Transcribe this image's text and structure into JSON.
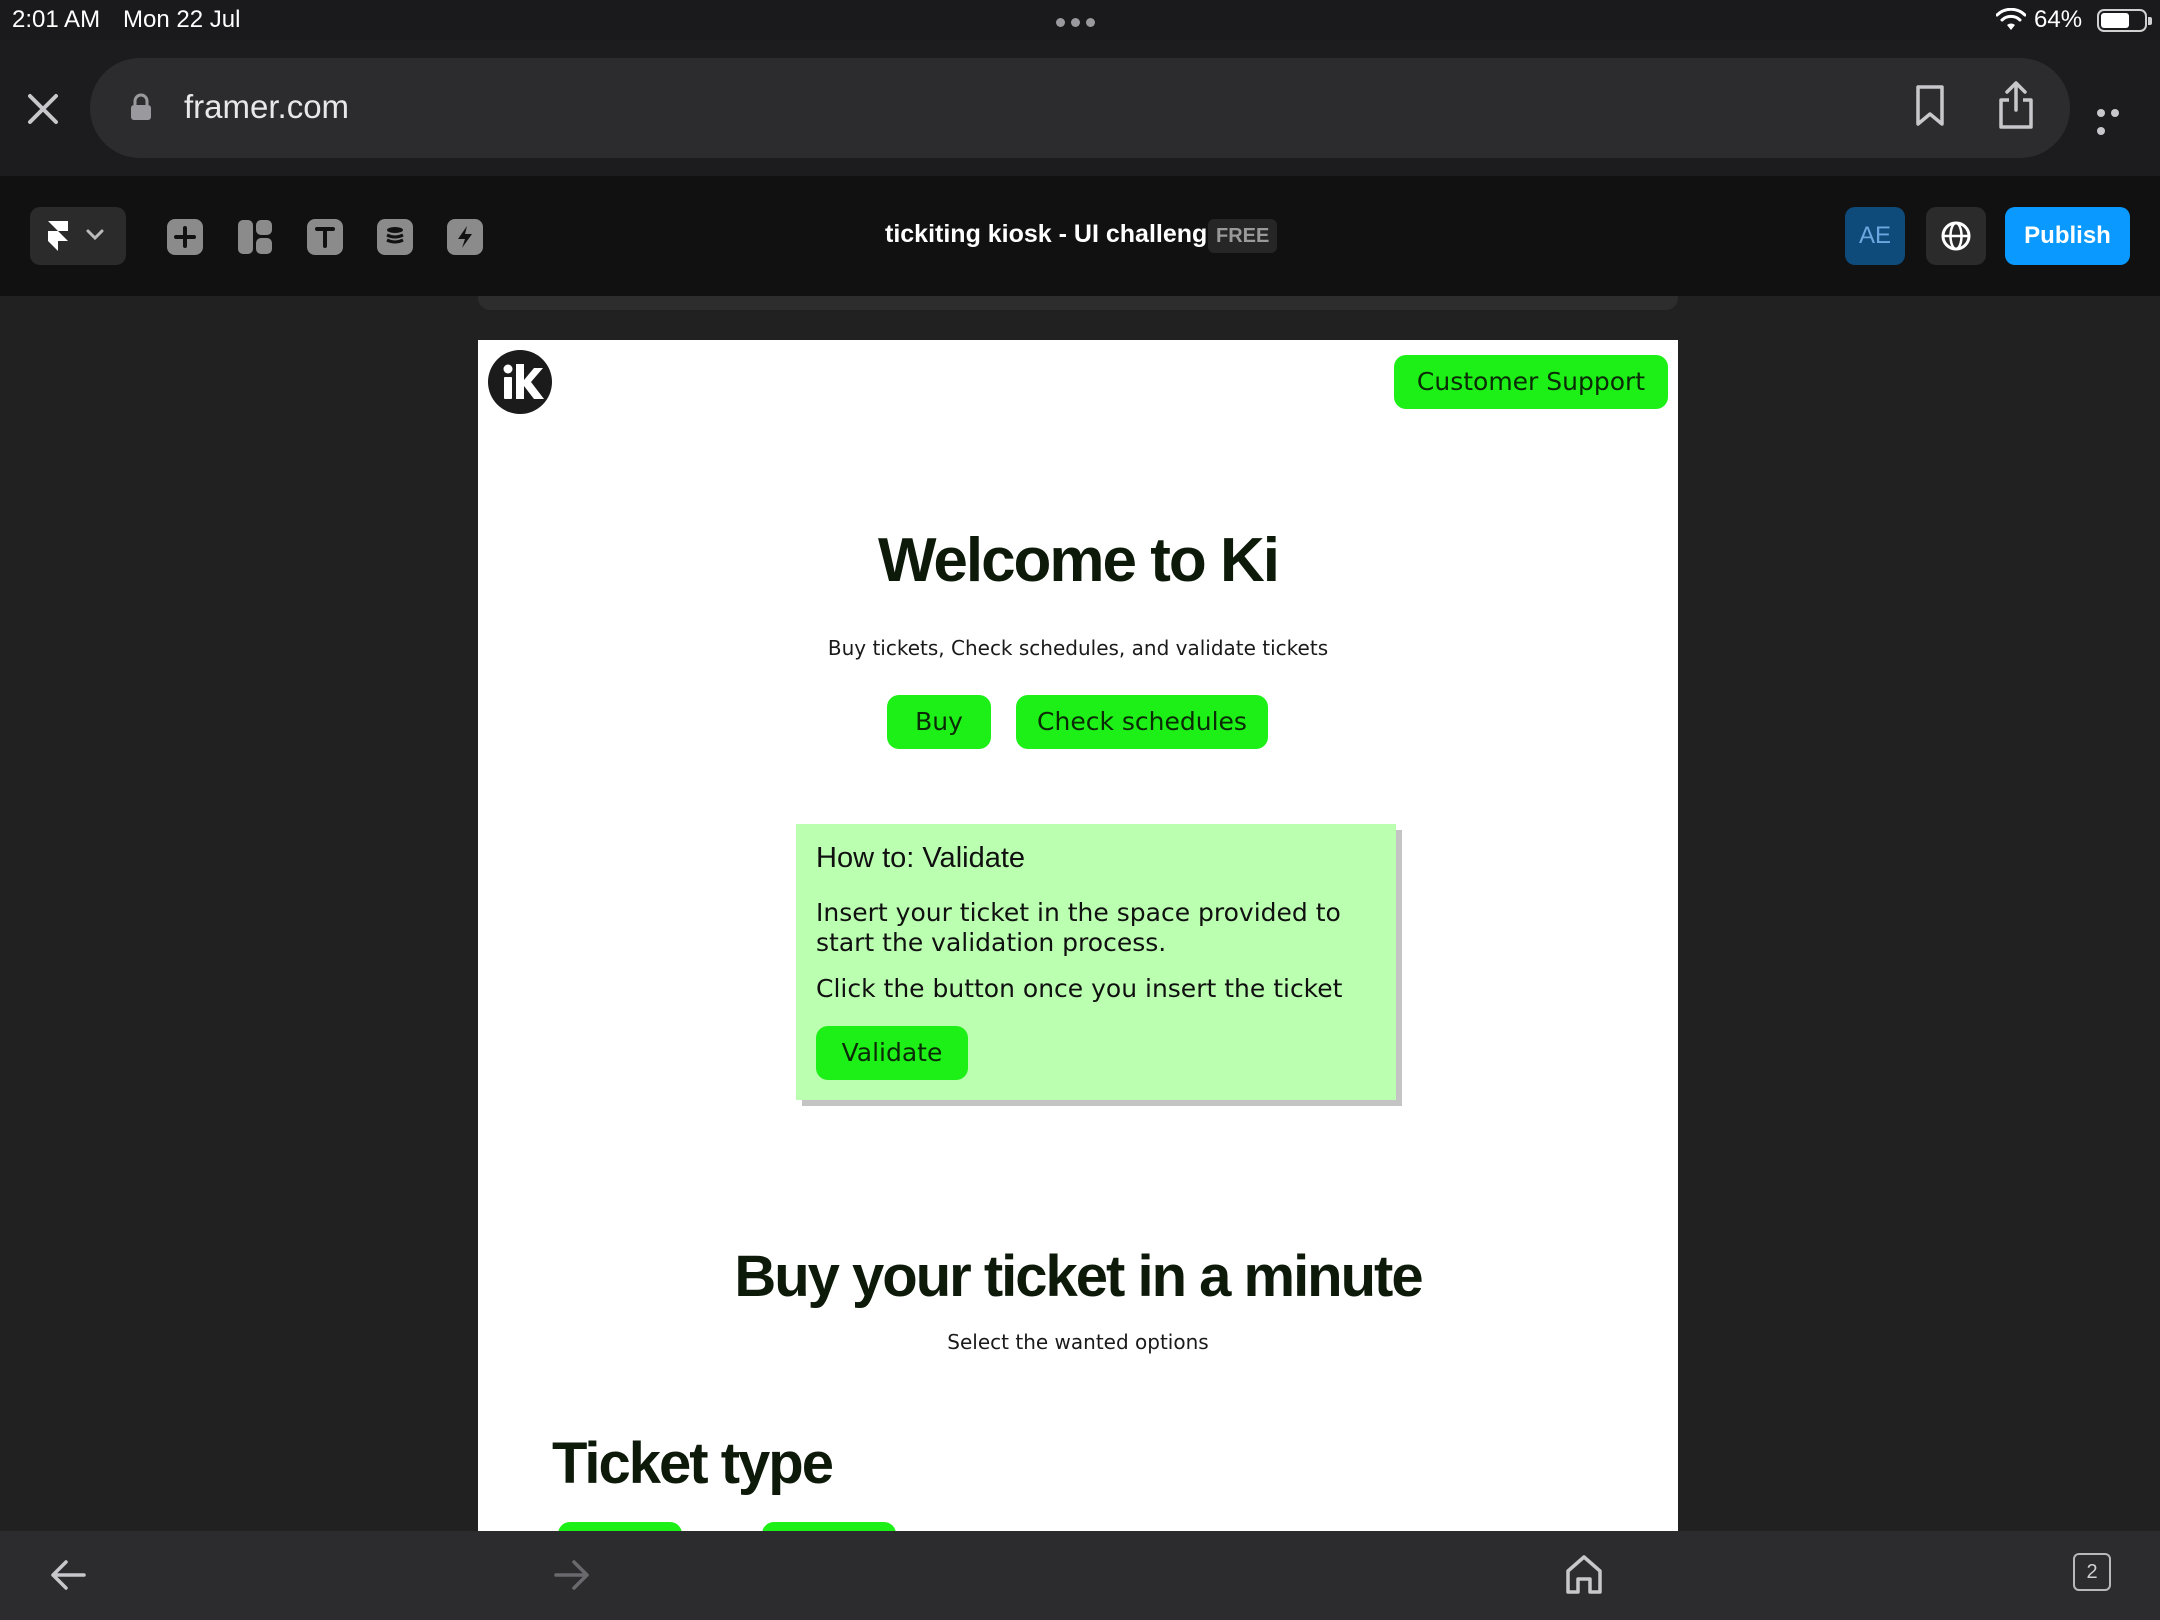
{
  "status_bar": {
    "time": "2:01 AM",
    "date": "Mon 22 Jul",
    "battery": "64%"
  },
  "browser": {
    "url": "framer.com",
    "tab_count": "2"
  },
  "framer_toolbar": {
    "project_title": "tickiting kiosk - UI challeng",
    "plan_badge": "FREE",
    "avatar_initials": "AE",
    "publish_label": "Publish"
  },
  "site": {
    "customer_support_label": "Customer Support",
    "welcome_title": "Welcome to Ki",
    "welcome_subtitle": "Buy tickets, Check schedules, and validate tickets",
    "buy_label": "Buy",
    "check_schedules_label": "Check schedules",
    "howto": {
      "title": "How to: Validate",
      "paragraph1": "Insert your ticket in the space provided to start the validation process.",
      "paragraph2": "Click the button once you insert the ticket",
      "validate_label": "Validate"
    },
    "buy_section_title": "Buy your ticket in a minute",
    "buy_section_subtitle": "Select the wanted options",
    "ticket_type_title": "Ticket type"
  },
  "colors": {
    "accent_green": "#1cf016",
    "card_green": "#bbffb0",
    "publish_blue": "#0a99ff"
  },
  "icons": {
    "close": "close-icon",
    "lock": "lock-icon",
    "bookmark": "bookmark-icon",
    "share": "share-icon",
    "more": "more-icon",
    "framer": "framer-logo-icon",
    "insert": "plus-icon",
    "layout": "layout-icon",
    "text": "text-icon",
    "cms": "database-icon",
    "interactions": "bolt-icon",
    "globe": "globe-icon",
    "back": "back-arrow-icon",
    "forward": "forward-arrow-icon",
    "home": "home-icon",
    "tabs": "tabs-icon"
  }
}
